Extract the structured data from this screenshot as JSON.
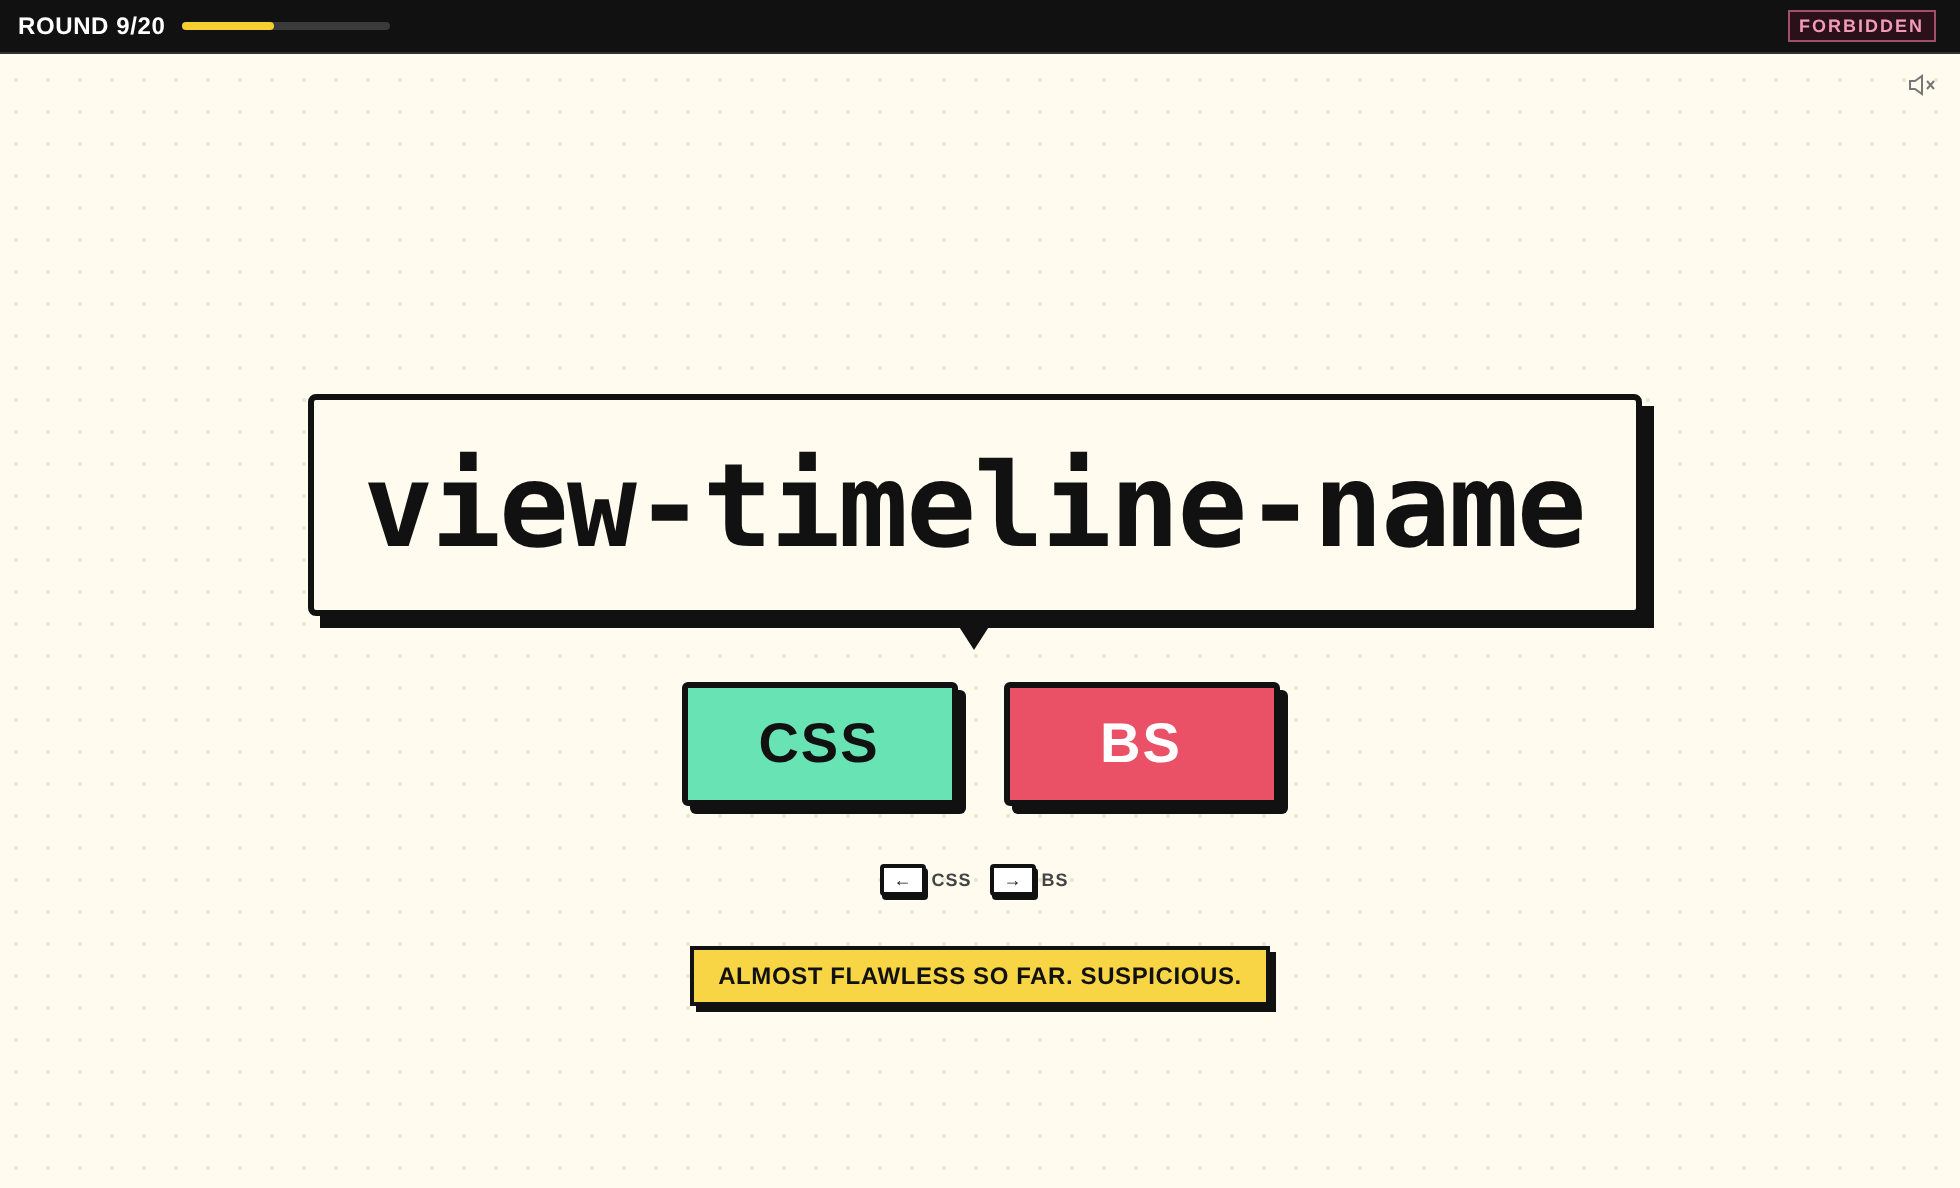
{
  "header": {
    "round": "ROUND 9/20",
    "progress": {
      "level": 0.45
    },
    "badge": "FORBIDDEN"
  },
  "term": "view-timeline-name",
  "buttons": [
    {
      "label": "CSS",
      "kind": "css"
    },
    {
      "label": "BS",
      "kind": "bs"
    }
  ],
  "hints": [
    {
      "key": "←",
      "label": "CSS"
    },
    {
      "key": "→",
      "label": "BS"
    }
  ],
  "message": "ALMOST FLAWLESS SO FAR. SUSPICIOUS."
}
